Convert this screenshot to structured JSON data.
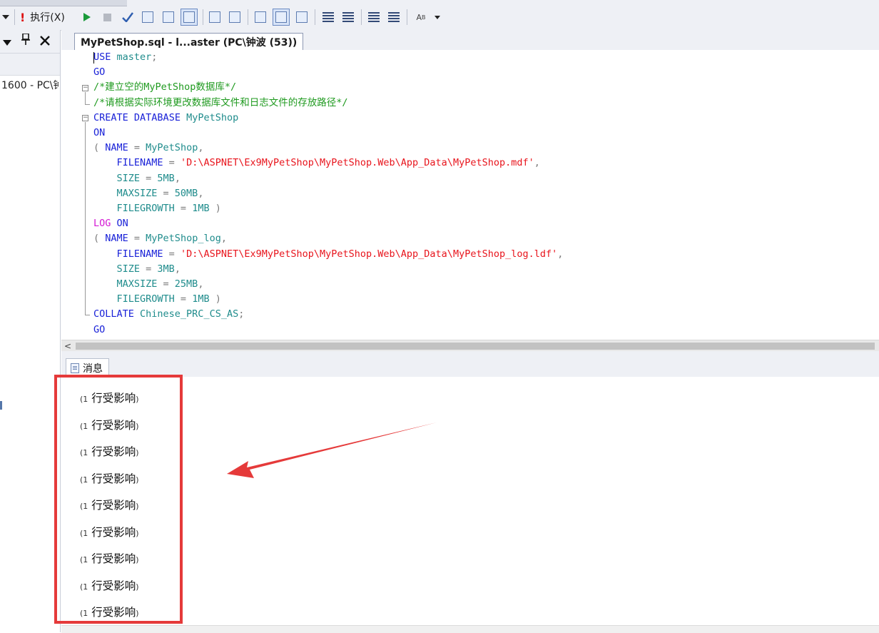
{
  "toolbar": {
    "execute_label": "执行(X)",
    "icons": [
      "dropdown-arrow-icon",
      "execute-icon",
      "play-icon",
      "stop-icon",
      "parse-check-icon",
      "query-options-icon",
      "results-to-text-icon",
      "results-to-grid-icon",
      "results-to-file-icon",
      "include-plan-icon",
      "display-plan-icon",
      "comment-icon",
      "uncomment-icon",
      "decrease-indent-icon",
      "increase-indent-icon",
      "specify-template-values-icon",
      "toolbar-overflow-icon"
    ]
  },
  "left_panel": {
    "header_icons": [
      "dropdown-icon",
      "pin-icon",
      "close-icon"
    ],
    "server_node": "1600 - PC\\钟"
  },
  "editor": {
    "tab_title": "MyPetShop.sql - l...aster (PC\\钟波 (53))",
    "code_lines": [
      [
        {
          "t": "USE",
          "c": "kw"
        },
        {
          "t": " master",
          "c": "nm"
        },
        {
          "t": ";",
          "c": "gr"
        }
      ],
      [
        {
          "t": "GO",
          "c": "kw"
        }
      ],
      [
        {
          "t": "/*建立空的MyPetShop数据库*/",
          "c": "cm"
        }
      ],
      [
        {
          "t": "/*请根据实际环境更改数据库文件和日志文件的存放路径*/",
          "c": "cm"
        }
      ],
      [
        {
          "t": "CREATE",
          "c": "kw"
        },
        {
          "t": " ",
          "c": "bk"
        },
        {
          "t": "DATABASE",
          "c": "kw"
        },
        {
          "t": " MyPetShop",
          "c": "nm"
        }
      ],
      [
        {
          "t": "ON",
          "c": "kw"
        }
      ],
      [
        {
          "t": "( ",
          "c": "gr"
        },
        {
          "t": "NAME",
          "c": "kw"
        },
        {
          "t": " = ",
          "c": "gr"
        },
        {
          "t": "MyPetShop",
          "c": "nm"
        },
        {
          "t": ",",
          "c": "gr"
        }
      ],
      [
        {
          "t": "    FILENAME",
          "c": "kw"
        },
        {
          "t": " = ",
          "c": "gr"
        },
        {
          "t": "'D:\\ASPNET\\Ex9MyPetShop\\MyPetShop.Web\\App_Data\\MyPetShop.mdf'",
          "c": "str"
        },
        {
          "t": ",",
          "c": "gr"
        }
      ],
      [
        {
          "t": "    SIZE",
          "c": "nm"
        },
        {
          "t": " = ",
          "c": "gr"
        },
        {
          "t": "5MB",
          "c": "nm"
        },
        {
          "t": ",",
          "c": "gr"
        }
      ],
      [
        {
          "t": "    MAXSIZE",
          "c": "nm"
        },
        {
          "t": " = ",
          "c": "gr"
        },
        {
          "t": "50MB",
          "c": "nm"
        },
        {
          "t": ",",
          "c": "gr"
        }
      ],
      [
        {
          "t": "    FILEGROWTH",
          "c": "nm"
        },
        {
          "t": " = ",
          "c": "gr"
        },
        {
          "t": "1MB",
          "c": "nm"
        },
        {
          "t": " )",
          "c": "gr"
        }
      ],
      [
        {
          "t": "LOG",
          "c": "pk"
        },
        {
          "t": " ",
          "c": "bk"
        },
        {
          "t": "ON",
          "c": "kw"
        }
      ],
      [
        {
          "t": "( ",
          "c": "gr"
        },
        {
          "t": "NAME",
          "c": "kw"
        },
        {
          "t": " = ",
          "c": "gr"
        },
        {
          "t": "MyPetShop_log",
          "c": "nm"
        },
        {
          "t": ",",
          "c": "gr"
        }
      ],
      [
        {
          "t": "    FILENAME",
          "c": "kw"
        },
        {
          "t": " = ",
          "c": "gr"
        },
        {
          "t": "'D:\\ASPNET\\Ex9MyPetShop\\MyPetShop.Web\\App_Data\\MyPetShop_log.ldf'",
          "c": "str"
        },
        {
          "t": ",",
          "c": "gr"
        }
      ],
      [
        {
          "t": "    SIZE",
          "c": "nm"
        },
        {
          "t": " = ",
          "c": "gr"
        },
        {
          "t": "3MB",
          "c": "nm"
        },
        {
          "t": ",",
          "c": "gr"
        }
      ],
      [
        {
          "t": "    MAXSIZE",
          "c": "nm"
        },
        {
          "t": " = ",
          "c": "gr"
        },
        {
          "t": "25MB",
          "c": "nm"
        },
        {
          "t": ",",
          "c": "gr"
        }
      ],
      [
        {
          "t": "    FILEGROWTH",
          "c": "nm"
        },
        {
          "t": " = ",
          "c": "gr"
        },
        {
          "t": "1MB",
          "c": "nm"
        },
        {
          "t": " )",
          "c": "gr"
        }
      ],
      [
        {
          "t": "COLLATE",
          "c": "kw"
        },
        {
          "t": " Chinese_PRC_CS_AS",
          "c": "nm"
        },
        {
          "t": ";",
          "c": "gr"
        }
      ],
      [
        {
          "t": "GO",
          "c": "kw"
        }
      ]
    ]
  },
  "messages": {
    "tab_label": "消息",
    "lines": [
      {
        "open": "(",
        "count": "1",
        "text": " 行受影响",
        "close": ")"
      },
      {
        "open": "(",
        "count": "1",
        "text": " 行受影响",
        "close": ")"
      },
      {
        "open": "(",
        "count": "1",
        "text": " 行受影响",
        "close": ")"
      },
      {
        "open": "(",
        "count": "1",
        "text": " 行受影响",
        "close": ")"
      },
      {
        "open": "(",
        "count": "1",
        "text": " 行受影响",
        "close": ")"
      },
      {
        "open": "(",
        "count": "1",
        "text": " 行受影响",
        "close": ")"
      },
      {
        "open": "(",
        "count": "1",
        "text": " 行受影响",
        "close": ")"
      },
      {
        "open": "(",
        "count": "1",
        "text": " 行受影响",
        "close": ")"
      },
      {
        "open": "(",
        "count": "1",
        "text": " 行受影响",
        "close": ")"
      }
    ]
  },
  "annotation": {
    "color": "#e53a3a"
  }
}
